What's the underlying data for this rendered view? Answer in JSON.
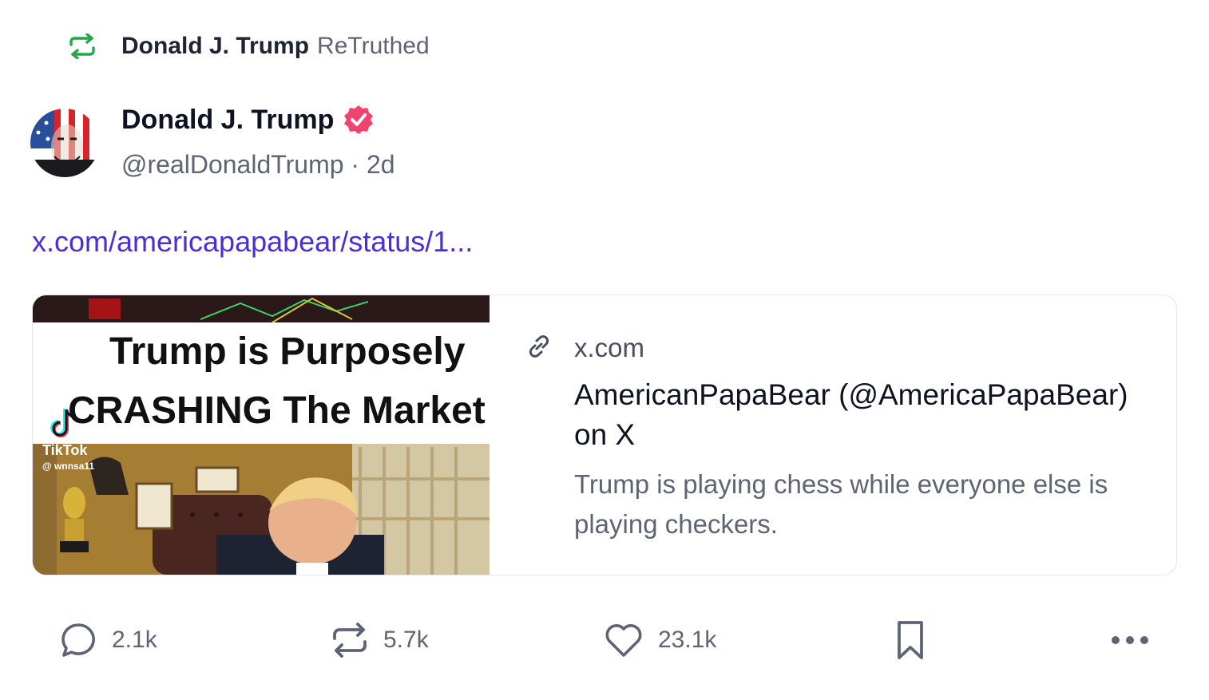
{
  "retruth": {
    "user_name": "Donald J. Trump",
    "action_label": "ReTruthed",
    "icon": "retruth-icon",
    "icon_color": "#27a34a"
  },
  "author": {
    "name": "Donald J. Trump",
    "handle": "@realDonaldTrump",
    "separator": "·",
    "age": "2d",
    "verified_icon": "verified-badge-icon",
    "verified_color": "#f0436e"
  },
  "post": {
    "link_text": "x.com/americapapabear/status/1...",
    "link_color": "#4b2fd6"
  },
  "link_card": {
    "domain": "x.com",
    "domain_icon": "link-icon",
    "title": "AmericanPapaBear (@AmericaPapaBear) on X",
    "description": "Trump is playing chess while everyone else is playing checkers.",
    "thumbnail": {
      "headline_line1": "Trump is Purposely",
      "headline_line2": "CRASHING The Market",
      "watermark_brand": "TikTok",
      "watermark_handle": "@ wnnsa11"
    }
  },
  "actions": {
    "reply": {
      "icon": "reply-icon",
      "count": "2.1k"
    },
    "retruth": {
      "icon": "retruth-icon",
      "count": "5.7k"
    },
    "like": {
      "icon": "heart-icon",
      "count": "23.1k"
    },
    "bookmark": {
      "icon": "bookmark-icon"
    },
    "more": {
      "icon": "more-icon"
    }
  }
}
